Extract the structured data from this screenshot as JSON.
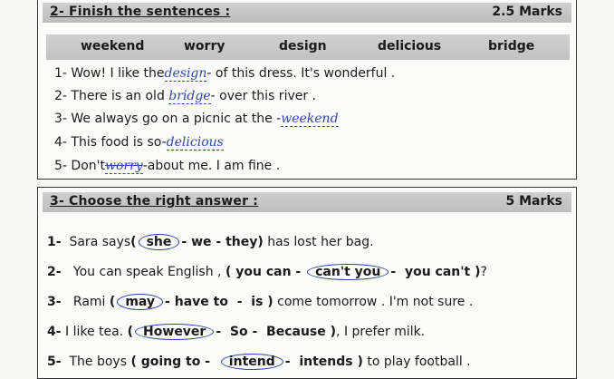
{
  "section2": {
    "title": "2- Finish the sentences  :",
    "marks": "2.5 Marks",
    "word_bank": [
      "weekend",
      "worry",
      "design",
      "delicious",
      "bridge"
    ],
    "sentences": [
      {
        "pre": "1- Wow! I like the",
        "answer": "design",
        "post": "- of this dress. It's wonderful ."
      },
      {
        "pre": "2-  There is an old",
        "answer": "bridge",
        "post": "- over this river ."
      },
      {
        "pre": "3-  We always go on a picnic at the -",
        "answer": "weekend",
        "post": ""
      },
      {
        "pre": "4-  This food is so-",
        "answer": "delicious",
        "post": ""
      },
      {
        "pre": "5- Don't",
        "answer": "worry",
        "post": "-about me. I am fine   ."
      }
    ]
  },
  "section3": {
    "title": "3- Choose the right answer  :",
    "marks": "5 Marks",
    "items": [
      {
        "num": "1-",
        "pre": "Sara says",
        "options": [
          "she",
          "we",
          "they"
        ],
        "choice": 0,
        "post": "has lost her bag."
      },
      {
        "num": "2-",
        "pre": "You can speak English ,",
        "options": [
          "you can",
          "can't you",
          "you can't"
        ],
        "choice": 1,
        "post": "?"
      },
      {
        "num": "3-",
        "pre": "Rami",
        "options": [
          "may",
          "have to",
          "is"
        ],
        "choice": 0,
        "post": "come tomorrow . I'm not sure  ."
      },
      {
        "num": "4-",
        "pre": "I like tea.",
        "options": [
          "However",
          "So",
          "Because"
        ],
        "choice": 0,
        "post": ", I prefer milk."
      },
      {
        "num": "5-",
        "pre": "The boys",
        "options": [
          "going to",
          "intend",
          "intends"
        ],
        "choice": 1,
        "post": "to play football ."
      }
    ]
  }
}
